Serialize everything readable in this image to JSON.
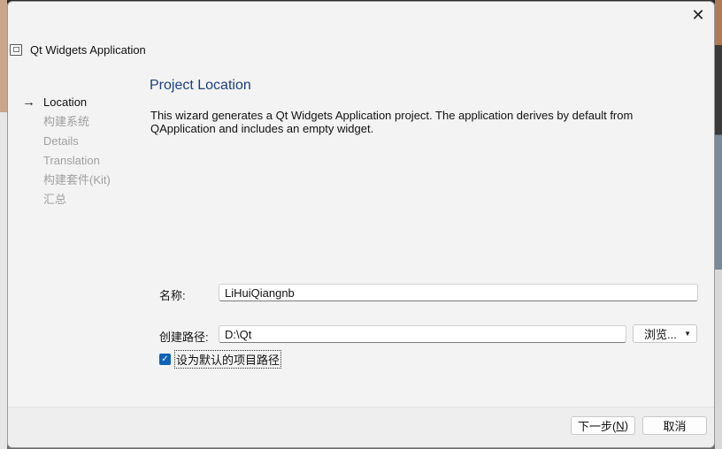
{
  "window": {
    "title": "Qt Widgets Application",
    "close_glyph": "✕"
  },
  "nav": {
    "arrow": "→",
    "items": [
      {
        "label": "Location",
        "active": true
      },
      {
        "label": "构建系统",
        "active": false
      },
      {
        "label": "Details",
        "active": false
      },
      {
        "label": "Translation",
        "active": false
      },
      {
        "label": "构建套件(Kit)",
        "active": false
      },
      {
        "label": "汇总",
        "active": false
      }
    ]
  },
  "page": {
    "heading": "Project Location",
    "description": "This wizard generates a Qt Widgets Application project. The application derives by default from QApplication and includes an empty widget."
  },
  "form": {
    "name_label": "名称:",
    "name_value": "LiHuiQiangnb",
    "path_label": "创建路径:",
    "path_value": "D:\\Qt",
    "browse_label": "浏览...",
    "default_path_checkbox": {
      "label": "设为默认的项目路径",
      "checked": true
    }
  },
  "footer": {
    "next_label_prefix": "下一步(",
    "next_mnemonic": "N",
    "next_label_suffix": ")",
    "cancel_label": "取消"
  },
  "colors": {
    "accent": "#0f62b8",
    "heading": "#1c3f7f",
    "disabled_text": "#a0a0a0"
  },
  "icons": {
    "app": "qt-app-icon",
    "close": "close-icon",
    "nav_active": "arrow-right-icon",
    "dropdown": "chevron-down-icon",
    "check": "checkmark-icon"
  }
}
